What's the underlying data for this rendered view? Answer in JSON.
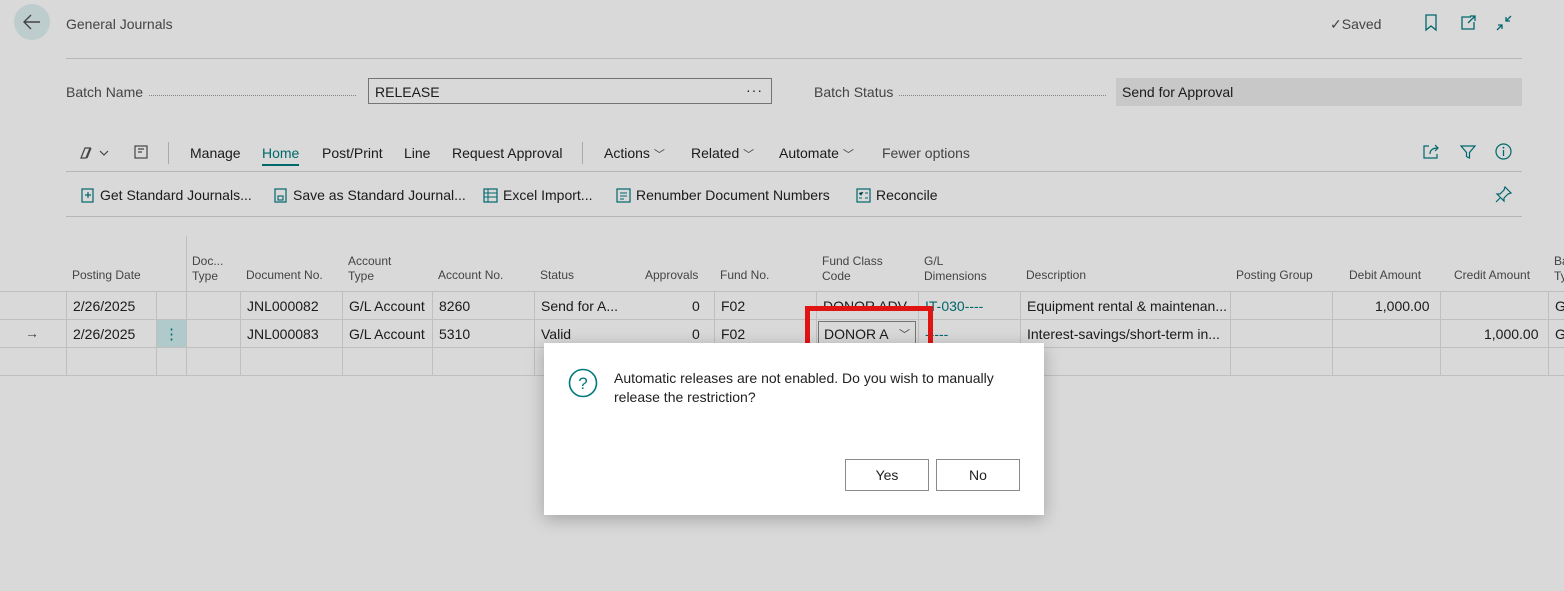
{
  "header": {
    "title": "General Journals",
    "saved_label": "Saved"
  },
  "fields": {
    "batch_name_label": "Batch Name",
    "batch_name_value": "RELEASE",
    "batch_name_lookup": "···",
    "batch_status_label": "Batch Status",
    "batch_status_value": "Send for Approval"
  },
  "menu": {
    "items": [
      "Manage",
      "Home",
      "Post/Print",
      "Line",
      "Request Approval"
    ],
    "dropdowns": [
      "Actions",
      "Related",
      "Automate"
    ],
    "fewer_options": "Fewer options",
    "active": "Home"
  },
  "actions": [
    "Get Standard Journals...",
    "Save as Standard Journal...",
    "Excel Import...",
    "Renumber Document Numbers",
    "Reconcile"
  ],
  "table": {
    "headers": {
      "posting_date": "Posting Date",
      "doc_type_1": "Doc...",
      "doc_type_2": "Type",
      "document_no": "Document No.",
      "account_type_1": "Account",
      "account_type_2": "Type",
      "account_no": "Account No.",
      "status": "Status",
      "approvals": "Approvals",
      "fund_no": "Fund No.",
      "fund_class_1": "Fund Class",
      "fund_class_2": "Code",
      "gl_dim_1": "G/L",
      "gl_dim_2": "Dimensions",
      "description": "Description",
      "posting_group": "Posting Group",
      "debit_amount": "Debit Amount",
      "credit_amount": "Credit Amount",
      "bal_type_1": "Ba",
      "bal_type_2": "Ty"
    },
    "rows": [
      {
        "posting_date": "2/26/2025",
        "document_no": "JNL000082",
        "account_type": "G/L Account",
        "account_no": "8260",
        "status": "Send for A...",
        "approvals": "0",
        "fund_no": "F02",
        "fund_class": "DONOR ADV",
        "gl_dimensions": "IT-030----",
        "description": "Equipment rental & maintenan...",
        "debit_amount": "1,000.00",
        "credit_amount": "",
        "bal_type": "G"
      },
      {
        "posting_date": "2/26/2025",
        "document_no": "JNL000083",
        "account_type": "G/L Account",
        "account_no": "5310",
        "status": "Valid",
        "approvals": "0",
        "fund_no": "F02",
        "fund_class": "DONOR A",
        "gl_dimensions": "-----",
        "description": "Interest-savings/short-term in...",
        "debit_amount": "",
        "credit_amount": "1,000.00",
        "bal_type": "G"
      }
    ]
  },
  "dialog": {
    "message": "Automatic releases are not enabled. Do you wish to manually release the restriction?",
    "yes_label": "Yes",
    "no_label": "No"
  },
  "colors": {
    "accent": "#00797e",
    "highlight": "#e11414"
  }
}
